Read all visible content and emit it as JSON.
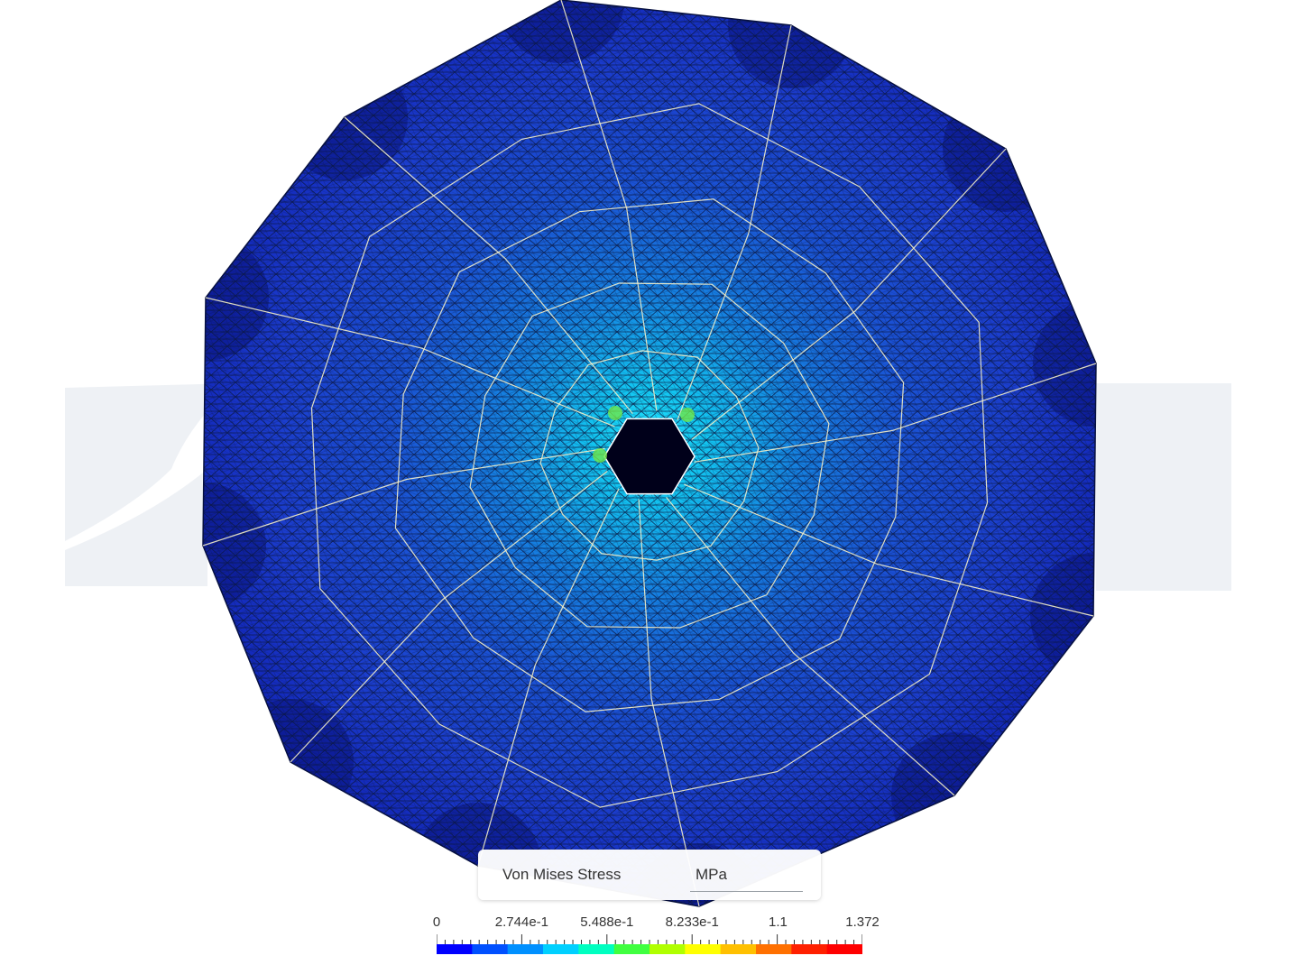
{
  "viewer": {
    "result_type": "Von Mises Stress",
    "unit": "MPa",
    "mesh": "triangular-mesh",
    "watermark_color": "#eef1f5"
  },
  "legend": {
    "title": "Von Mises Stress",
    "unit": "MPa",
    "min": 0,
    "max": 1.372,
    "tick_labels": [
      "0",
      "2.744e-1",
      "5.488e-1",
      "8.233e-1",
      "1.1",
      "1.372"
    ],
    "tick_values": [
      0,
      0.2744,
      0.5488,
      0.8233,
      1.1,
      1.372
    ],
    "colors": [
      "#0000ff",
      "#0050ff",
      "#0090ff",
      "#00d0ff",
      "#00ffc0",
      "#40ff40",
      "#b0ff00",
      "#ffff00",
      "#ffc000",
      "#ff7000",
      "#ff2000",
      "#ff0000"
    ]
  },
  "model": {
    "shape": "dodecagon-plate-with-hexagonal-hole",
    "base_color": "#1f3fcf",
    "edge_color": "#0b1a4a",
    "partition_line_color": "#f5f0c8",
    "hotspot_color": "#22e0ff"
  }
}
